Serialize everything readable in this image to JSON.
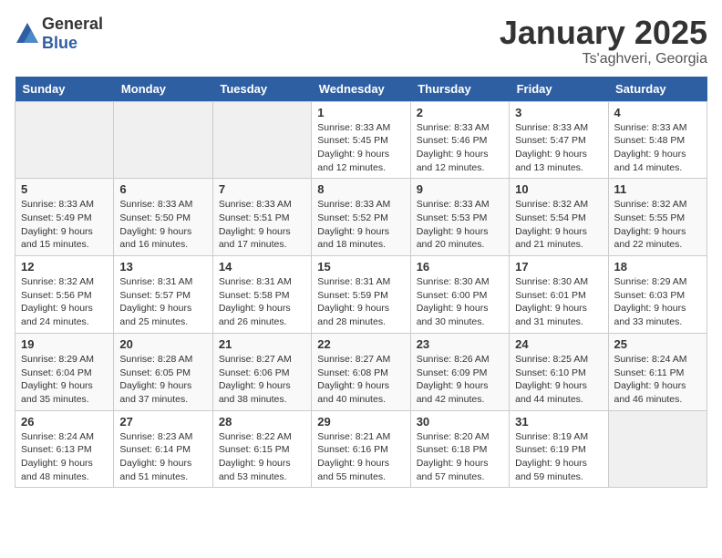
{
  "header": {
    "logo_general": "General",
    "logo_blue": "Blue",
    "month_year": "January 2025",
    "location": "Ts'aghveri, Georgia"
  },
  "days_of_week": [
    "Sunday",
    "Monday",
    "Tuesday",
    "Wednesday",
    "Thursday",
    "Friday",
    "Saturday"
  ],
  "weeks": [
    [
      {
        "day": "",
        "data": ""
      },
      {
        "day": "",
        "data": ""
      },
      {
        "day": "",
        "data": ""
      },
      {
        "day": "1",
        "data": "Sunrise: 8:33 AM\nSunset: 5:45 PM\nDaylight: 9 hours and 12 minutes."
      },
      {
        "day": "2",
        "data": "Sunrise: 8:33 AM\nSunset: 5:46 PM\nDaylight: 9 hours and 12 minutes."
      },
      {
        "day": "3",
        "data": "Sunrise: 8:33 AM\nSunset: 5:47 PM\nDaylight: 9 hours and 13 minutes."
      },
      {
        "day": "4",
        "data": "Sunrise: 8:33 AM\nSunset: 5:48 PM\nDaylight: 9 hours and 14 minutes."
      }
    ],
    [
      {
        "day": "5",
        "data": "Sunrise: 8:33 AM\nSunset: 5:49 PM\nDaylight: 9 hours and 15 minutes."
      },
      {
        "day": "6",
        "data": "Sunrise: 8:33 AM\nSunset: 5:50 PM\nDaylight: 9 hours and 16 minutes."
      },
      {
        "day": "7",
        "data": "Sunrise: 8:33 AM\nSunset: 5:51 PM\nDaylight: 9 hours and 17 minutes."
      },
      {
        "day": "8",
        "data": "Sunrise: 8:33 AM\nSunset: 5:52 PM\nDaylight: 9 hours and 18 minutes."
      },
      {
        "day": "9",
        "data": "Sunrise: 8:33 AM\nSunset: 5:53 PM\nDaylight: 9 hours and 20 minutes."
      },
      {
        "day": "10",
        "data": "Sunrise: 8:32 AM\nSunset: 5:54 PM\nDaylight: 9 hours and 21 minutes."
      },
      {
        "day": "11",
        "data": "Sunrise: 8:32 AM\nSunset: 5:55 PM\nDaylight: 9 hours and 22 minutes."
      }
    ],
    [
      {
        "day": "12",
        "data": "Sunrise: 8:32 AM\nSunset: 5:56 PM\nDaylight: 9 hours and 24 minutes."
      },
      {
        "day": "13",
        "data": "Sunrise: 8:31 AM\nSunset: 5:57 PM\nDaylight: 9 hours and 25 minutes."
      },
      {
        "day": "14",
        "data": "Sunrise: 8:31 AM\nSunset: 5:58 PM\nDaylight: 9 hours and 26 minutes."
      },
      {
        "day": "15",
        "data": "Sunrise: 8:31 AM\nSunset: 5:59 PM\nDaylight: 9 hours and 28 minutes."
      },
      {
        "day": "16",
        "data": "Sunrise: 8:30 AM\nSunset: 6:00 PM\nDaylight: 9 hours and 30 minutes."
      },
      {
        "day": "17",
        "data": "Sunrise: 8:30 AM\nSunset: 6:01 PM\nDaylight: 9 hours and 31 minutes."
      },
      {
        "day": "18",
        "data": "Sunrise: 8:29 AM\nSunset: 6:03 PM\nDaylight: 9 hours and 33 minutes."
      }
    ],
    [
      {
        "day": "19",
        "data": "Sunrise: 8:29 AM\nSunset: 6:04 PM\nDaylight: 9 hours and 35 minutes."
      },
      {
        "day": "20",
        "data": "Sunrise: 8:28 AM\nSunset: 6:05 PM\nDaylight: 9 hours and 37 minutes."
      },
      {
        "day": "21",
        "data": "Sunrise: 8:27 AM\nSunset: 6:06 PM\nDaylight: 9 hours and 38 minutes."
      },
      {
        "day": "22",
        "data": "Sunrise: 8:27 AM\nSunset: 6:08 PM\nDaylight: 9 hours and 40 minutes."
      },
      {
        "day": "23",
        "data": "Sunrise: 8:26 AM\nSunset: 6:09 PM\nDaylight: 9 hours and 42 minutes."
      },
      {
        "day": "24",
        "data": "Sunrise: 8:25 AM\nSunset: 6:10 PM\nDaylight: 9 hours and 44 minutes."
      },
      {
        "day": "25",
        "data": "Sunrise: 8:24 AM\nSunset: 6:11 PM\nDaylight: 9 hours and 46 minutes."
      }
    ],
    [
      {
        "day": "26",
        "data": "Sunrise: 8:24 AM\nSunset: 6:13 PM\nDaylight: 9 hours and 48 minutes."
      },
      {
        "day": "27",
        "data": "Sunrise: 8:23 AM\nSunset: 6:14 PM\nDaylight: 9 hours and 51 minutes."
      },
      {
        "day": "28",
        "data": "Sunrise: 8:22 AM\nSunset: 6:15 PM\nDaylight: 9 hours and 53 minutes."
      },
      {
        "day": "29",
        "data": "Sunrise: 8:21 AM\nSunset: 6:16 PM\nDaylight: 9 hours and 55 minutes."
      },
      {
        "day": "30",
        "data": "Sunrise: 8:20 AM\nSunset: 6:18 PM\nDaylight: 9 hours and 57 minutes."
      },
      {
        "day": "31",
        "data": "Sunrise: 8:19 AM\nSunset: 6:19 PM\nDaylight: 9 hours and 59 minutes."
      },
      {
        "day": "",
        "data": ""
      }
    ]
  ]
}
